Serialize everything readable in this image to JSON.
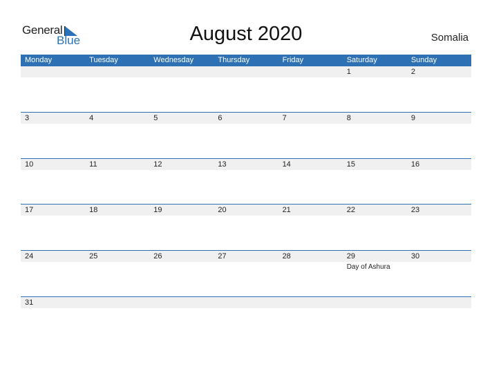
{
  "brand": {
    "line1": "General",
    "line2": "Blue",
    "accent": "#2d70b3"
  },
  "title": "August 2020",
  "country": "Somalia",
  "weekdays": [
    "Monday",
    "Tuesday",
    "Wednesday",
    "Thursday",
    "Friday",
    "Saturday",
    "Sunday"
  ],
  "weeks": [
    {
      "days": [
        "",
        "",
        "",
        "",
        "",
        "1",
        "2"
      ],
      "notes": [
        "",
        "",
        "",
        "",
        "",
        "",
        ""
      ]
    },
    {
      "days": [
        "3",
        "4",
        "5",
        "6",
        "7",
        "8",
        "9"
      ],
      "notes": [
        "",
        "",
        "",
        "",
        "",
        "",
        ""
      ]
    },
    {
      "days": [
        "10",
        "11",
        "12",
        "13",
        "14",
        "15",
        "16"
      ],
      "notes": [
        "",
        "",
        "",
        "",
        "",
        "",
        ""
      ]
    },
    {
      "days": [
        "17",
        "18",
        "19",
        "20",
        "21",
        "22",
        "23"
      ],
      "notes": [
        "",
        "",
        "",
        "",
        "",
        "",
        ""
      ]
    },
    {
      "days": [
        "24",
        "25",
        "26",
        "27",
        "28",
        "29",
        "30"
      ],
      "notes": [
        "",
        "",
        "",
        "",
        "",
        "Day of Ashura",
        ""
      ]
    },
    {
      "days": [
        "31",
        "",
        "",
        "",
        "",
        "",
        ""
      ],
      "notes": [
        "",
        "",
        "",
        "",
        "",
        "",
        ""
      ]
    }
  ]
}
